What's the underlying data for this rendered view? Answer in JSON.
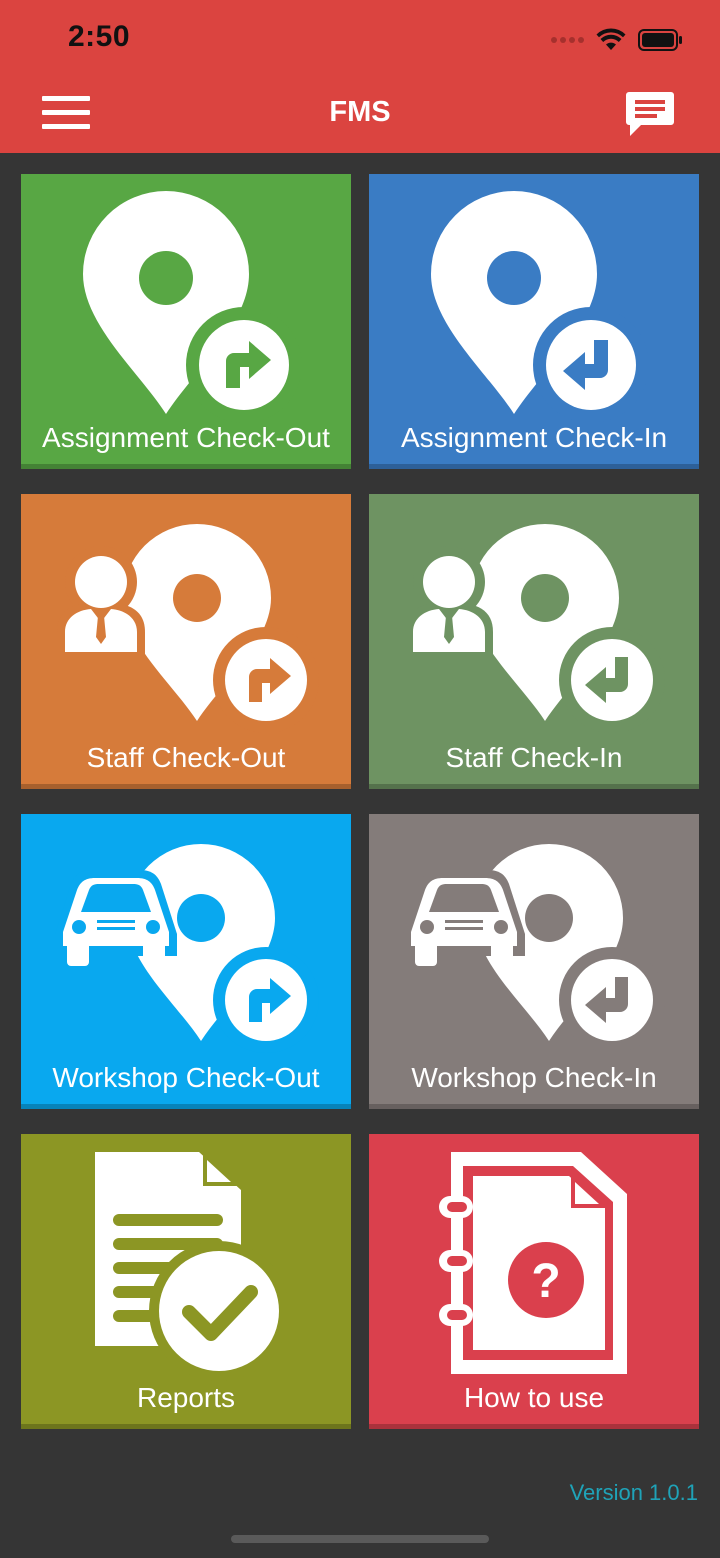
{
  "status_bar": {
    "time": "2:50"
  },
  "header": {
    "title": "FMS",
    "menu_icon": "hamburger-menu-icon",
    "message_icon": "chat-message-icon",
    "background_color": "#db4440"
  },
  "tiles": [
    {
      "label": "Assignment Check-Out",
      "color": "#58a744",
      "icon": "location-pin-arrow-out-icon"
    },
    {
      "label": "Assignment Check-In",
      "color": "#3a7cc4",
      "icon": "location-pin-arrow-in-icon"
    },
    {
      "label": "Staff Check-Out",
      "color": "#d67b3a",
      "icon": "staff-pin-arrow-out-icon"
    },
    {
      "label": "Staff Check-In",
      "color": "#6e9362",
      "icon": "staff-pin-arrow-in-icon"
    },
    {
      "label": "Workshop Check-Out",
      "color": "#09a8ef",
      "icon": "car-pin-arrow-out-icon"
    },
    {
      "label": "Workshop Check-In",
      "color": "#847c7a",
      "icon": "car-pin-arrow-in-icon"
    },
    {
      "label": "Reports",
      "color": "#8c9624",
      "icon": "report-document-check-icon"
    },
    {
      "label": "How to use",
      "color": "#da404d",
      "icon": "help-notebook-icon"
    }
  ],
  "footer": {
    "version": "Version 1.0.1"
  }
}
